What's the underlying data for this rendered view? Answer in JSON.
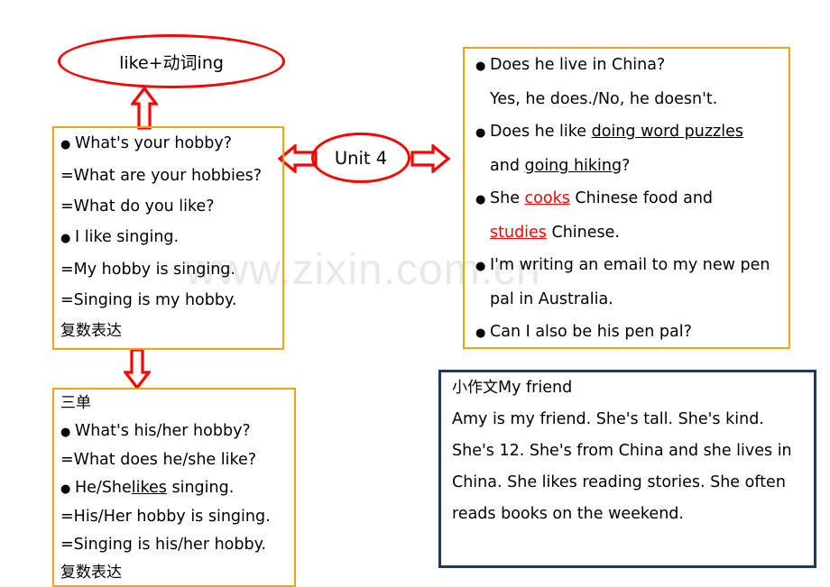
{
  "page": {
    "title": "Unit 4 hobbies grammar mind map",
    "watermark": "www.zixin.com.cn",
    "colors": {
      "box_orange": "#f6a016",
      "box_blue": "#1f3864",
      "accent_red": "#ff0000",
      "text_black": "#000000",
      "watermark_gray": "#e8e8e8",
      "background": "#ffffff"
    }
  },
  "ellipse_like": {
    "label": "like+动词ing"
  },
  "ellipse_unit": {
    "label": "Unit 4"
  },
  "box_hobby_singular": {
    "lines": [
      {
        "bullet": true,
        "text": "What's your hobby?"
      },
      {
        "bullet": false,
        "text": "=What are your hobbies?"
      },
      {
        "bullet": false,
        "text": "=What do you like?"
      },
      {
        "bullet": true,
        "text": "I like singing."
      },
      {
        "bullet": false,
        "text": "=My hobby is singing."
      },
      {
        "bullet": false,
        "text": "=Singing is my hobby."
      }
    ],
    "note": "复数表达"
  },
  "box_hobby_third": {
    "heading": "三单",
    "lines": [
      {
        "bullet": true,
        "pre": "What's his/her hobby?",
        "underline": "",
        "post": ""
      },
      {
        "bullet": false,
        "pre": "=What does he/she like?",
        "underline": "",
        "post": ""
      },
      {
        "bullet": true,
        "pre": "He/She",
        "underline": "likes",
        "post": " singing."
      },
      {
        "bullet": false,
        "pre": "=His/Her hobby is singing.",
        "underline": "",
        "post": ""
      },
      {
        "bullet": false,
        "pre": "=Singing is his/her hobby.",
        "underline": "",
        "post": ""
      }
    ],
    "note": "复数表达"
  },
  "box_questions": {
    "items": [
      {
        "bullet": true,
        "pre": "Does he live in China?",
        "underline": "",
        "post": "",
        "underline_color": ""
      },
      {
        "bullet": false,
        "pre": "Yes, he does./No, he doesn't.",
        "underline": "",
        "post": "",
        "underline_color": ""
      },
      {
        "bullet": true,
        "pre": "Does  he  like  ",
        "underline": "doing  word  puzzles",
        "post": "",
        "underline_color": "black"
      },
      {
        "bullet": false,
        "pre": "and ",
        "underline": "going hiking",
        "post": "?",
        "underline_color": "black"
      },
      {
        "bullet": true,
        "pre": "She ",
        "underline": "cooks",
        "post": " Chinese food and",
        "underline_color": "red"
      },
      {
        "bullet": false,
        "pre": "",
        "underline": "studies",
        "post": " Chinese.",
        "underline_color": "red"
      },
      {
        "bullet": true,
        "pre": "I'm writing an email to my new pen",
        "underline": "",
        "post": "",
        "underline_color": ""
      },
      {
        "bullet": false,
        "pre": "pal in Australia.",
        "underline": "",
        "post": "",
        "underline_color": ""
      },
      {
        "bullet": true,
        "pre": "Can I also be his pen pal?",
        "underline": "",
        "post": "",
        "underline_color": ""
      }
    ]
  },
  "box_writing": {
    "heading_cn": "小作文",
    "heading_en": "My friend",
    "lines": [
      "Amy is my friend. She's tall. She's kind.",
      "She's 12. She's from China and she lives in",
      "China. She likes reading stories. She often",
      "reads books on the weekend."
    ]
  },
  "arrows": {
    "up": "arrow-up",
    "down": "arrow-down",
    "left": "arrow-left",
    "right": "arrow-right"
  }
}
